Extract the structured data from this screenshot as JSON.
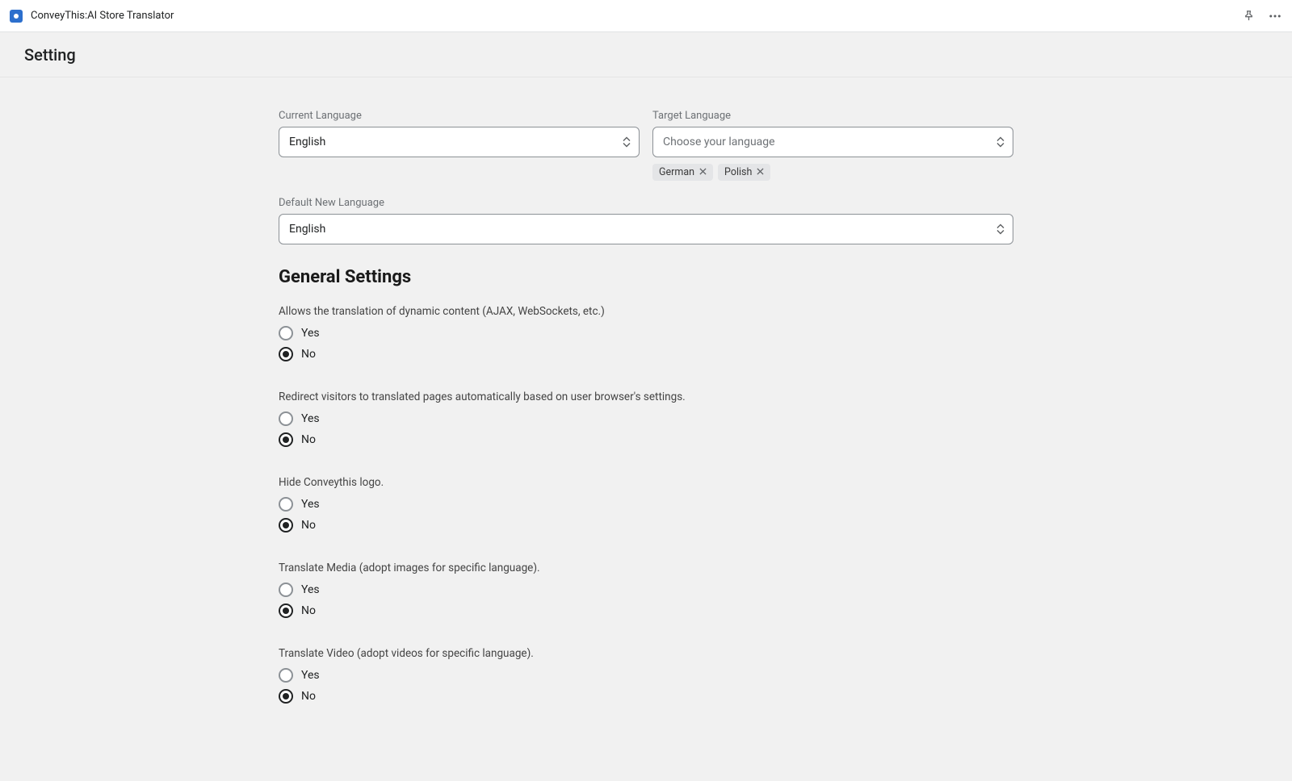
{
  "header": {
    "app_title": "ConveyThis:AI Store Translator"
  },
  "subheader": {
    "title": "Setting"
  },
  "languages": {
    "current_label": "Current Language",
    "current_value": "English",
    "target_label": "Target Language",
    "target_placeholder": "Choose your language",
    "target_chips": [
      "German",
      "Polish"
    ],
    "default_new_label": "Default New Language",
    "default_new_value": "English"
  },
  "general": {
    "heading": "General Settings",
    "yes": "Yes",
    "no": "No",
    "settings": [
      {
        "label": "Allows the translation of dynamic content (AJAX, WebSockets, etc.)",
        "selected": "no"
      },
      {
        "label": "Redirect visitors to translated pages automatically based on user browser's settings.",
        "selected": "no"
      },
      {
        "label": "Hide Conveythis logo.",
        "selected": "no"
      },
      {
        "label": "Translate Media (adopt images for specific language).",
        "selected": "no"
      },
      {
        "label": "Translate Video (adopt videos for specific language).",
        "selected": "no"
      }
    ]
  }
}
